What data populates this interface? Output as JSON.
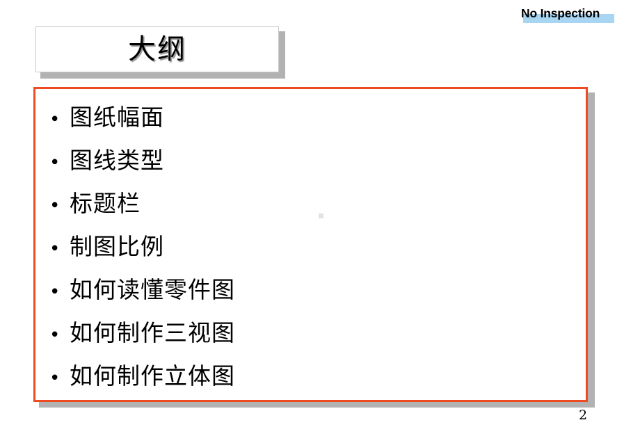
{
  "slide": {
    "background_color": "#ffffff",
    "page_number": "2"
  },
  "header": {
    "watermark_text": "No Inspection",
    "highlight_color": "#a8d5f2",
    "text_color": "#000000"
  },
  "title": {
    "text": "大纲",
    "box_background": "#ffffff",
    "box_border_color": "#c8c8c8",
    "shadow_color": "#b2b2b2"
  },
  "content": {
    "border_color": "#ef4b23",
    "shadow_color": "#b2b2b2",
    "background": "#ffffff",
    "bullet_glyph": "•",
    "items": [
      {
        "label": "图纸幅面"
      },
      {
        "label": "图线类型"
      },
      {
        "label": "标题栏"
      },
      {
        "label": "制图比例"
      },
      {
        "label": "如何读懂零件图"
      },
      {
        "label": "如何制作三视图"
      },
      {
        "label": "如何制作立体图"
      }
    ]
  }
}
